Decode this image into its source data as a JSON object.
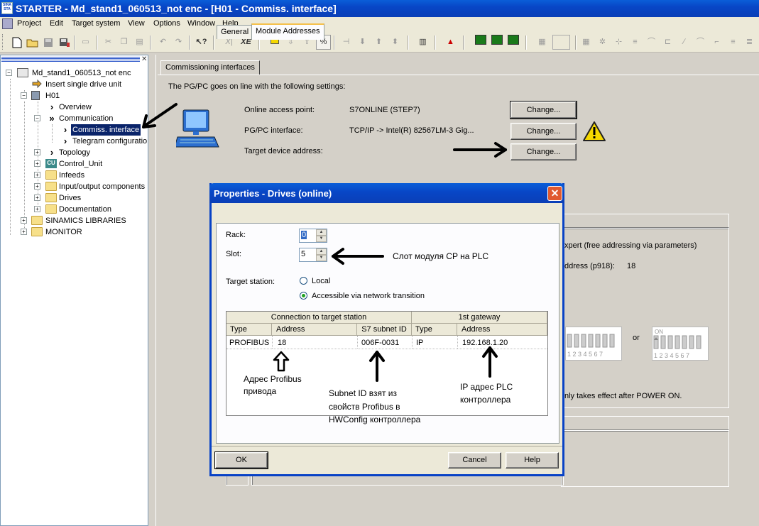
{
  "window": {
    "app_icon_text": "SINA STA",
    "title": "STARTER - Md_stand1_060513_not enc - [H01 - Commiss. interface]"
  },
  "menu": [
    "Project",
    "Edit",
    "Target system",
    "View",
    "Options",
    "Window",
    "Help"
  ],
  "toolbar": {
    "new": "new-icon",
    "open": "open-icon",
    "save": "save-icon",
    "xy_label": "X|",
    "xe_label": "XE"
  },
  "tree": {
    "items": [
      {
        "label": "Md_stand1_060513_not enc"
      },
      {
        "label": "Insert single drive unit"
      },
      {
        "label": "H01"
      },
      {
        "label": "Overview"
      },
      {
        "label": "Communication"
      },
      {
        "label": "Commiss. interface"
      },
      {
        "label": "Telegram configuratio"
      },
      {
        "label": "Topology"
      },
      {
        "label": "Control_Unit"
      },
      {
        "label": "Infeeds"
      },
      {
        "label": "Input/output components"
      },
      {
        "label": "Drives"
      },
      {
        "label": "Documentation"
      },
      {
        "label": "SINAMICS LIBRARIES"
      },
      {
        "label": "MONITOR"
      }
    ],
    "cu_badge": "CU"
  },
  "main": {
    "tab": "Commissioning interfaces",
    "intro": "The PG/PC goes on line with the following settings:",
    "rows": [
      {
        "label": "Online access point:",
        "value": "S7ONLINE (STEP7)",
        "button": "Change..."
      },
      {
        "label": "PG/PC interface:",
        "value": "TCP/IP -> Intel(R) 82567LM-3 Gig...",
        "button": "Change..."
      },
      {
        "label": "Target device address:",
        "value": "",
        "button": "Change..."
      }
    ],
    "bg_text_1": "xpert (free addressing via parameters)",
    "bg_text_2": "ddress (p918):",
    "bg_value_2": "18",
    "bg_or": "or",
    "bg_dip_on": "ON",
    "bg_dip_numbers": "1 2 3 4 5 6 7",
    "bg_text_3": "nly takes effect after POWER ON."
  },
  "dialog": {
    "title": "Properties - Drives (online)",
    "tabs": [
      "General",
      "Module Addresses"
    ],
    "rack_label": "Rack:",
    "rack_value": "0",
    "slot_label": "Slot:",
    "slot_value": "5",
    "target_station_label": "Target station:",
    "radio_local": "Local",
    "radio_network": "Accessible via network transition",
    "table": {
      "group_1": "Connection to target station",
      "group_2": "1st gateway",
      "headers": [
        "Type",
        "Address",
        "S7 subnet ID",
        "Type",
        "Address"
      ],
      "row": [
        "PROFIBUS",
        "18",
        "006F-0031",
        "IP",
        "192.168.1.20"
      ]
    },
    "buttons": {
      "ok": "OK",
      "cancel": "Cancel",
      "help": "Help"
    }
  },
  "annotations": {
    "slot": "Слот модуля CP  на PLC",
    "profibus_1": "Адрес Profibus",
    "profibus_2": "привода",
    "subnet_1": "Subnet ID взят из",
    "subnet_2": "свойств Profibus в",
    "subnet_3": "HWConfig контроллера",
    "ip_1": "IP адрес PLC",
    "ip_2": "контроллера"
  },
  "colors": {
    "titlebar": "#0a46c6",
    "selection": "#0a246a",
    "warning": "#f5d800",
    "dialog_close": "#e05a30"
  }
}
